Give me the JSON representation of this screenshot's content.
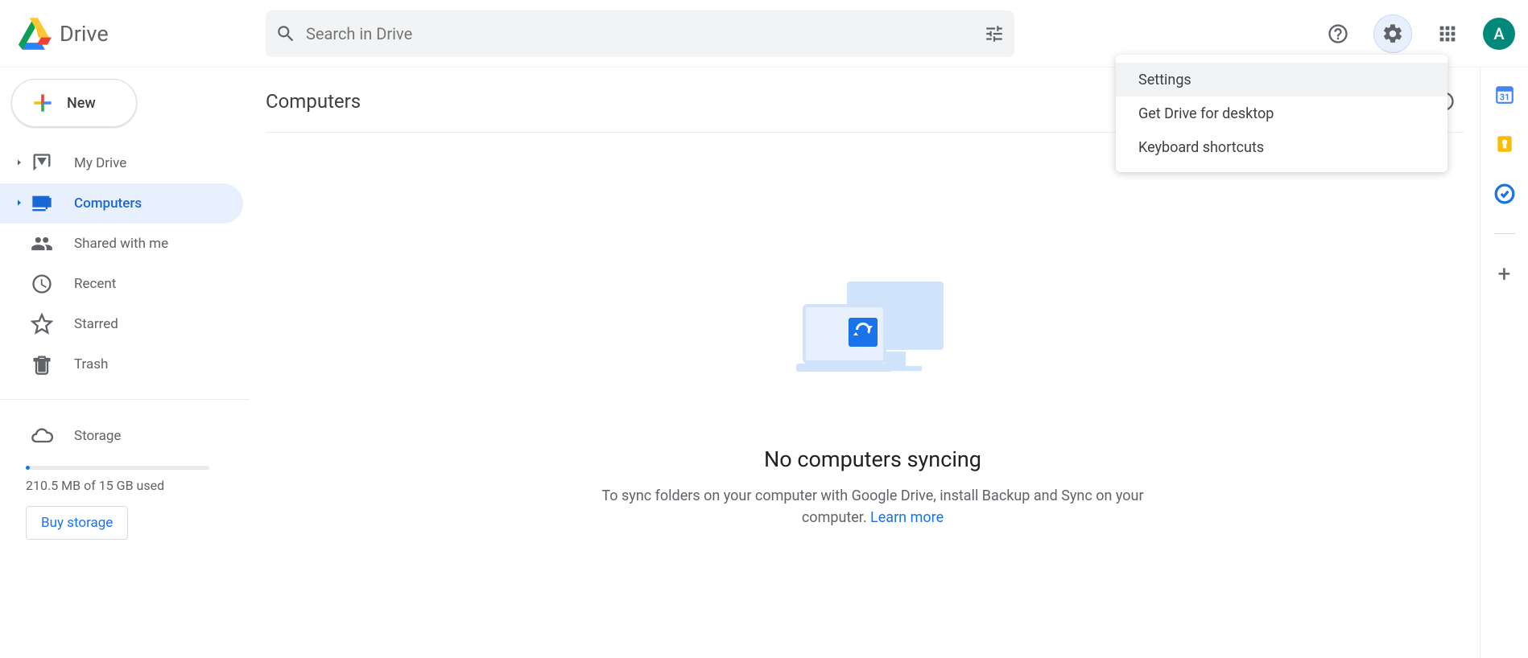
{
  "app": {
    "name": "Drive"
  },
  "search": {
    "placeholder": "Search in Drive"
  },
  "newButton": {
    "label": "New"
  },
  "sidebar": {
    "items": [
      {
        "label": "My Drive"
      },
      {
        "label": "Computers"
      },
      {
        "label": "Shared with me"
      },
      {
        "label": "Recent"
      },
      {
        "label": "Starred"
      },
      {
        "label": "Trash"
      }
    ],
    "storage": {
      "label": "Storage",
      "usage": "210.5 MB of 15 GB used",
      "buy": "Buy storage"
    }
  },
  "page": {
    "title": "Computers"
  },
  "settingsMenu": {
    "items": [
      {
        "label": "Settings"
      },
      {
        "label": "Get Drive for desktop"
      },
      {
        "label": "Keyboard shortcuts"
      }
    ]
  },
  "empty": {
    "title": "No computers syncing",
    "subtitle": "To sync folders on your computer with Google Drive, install Backup and Sync on your computer. ",
    "learn": "Learn more"
  },
  "avatar": {
    "initial": "A"
  }
}
